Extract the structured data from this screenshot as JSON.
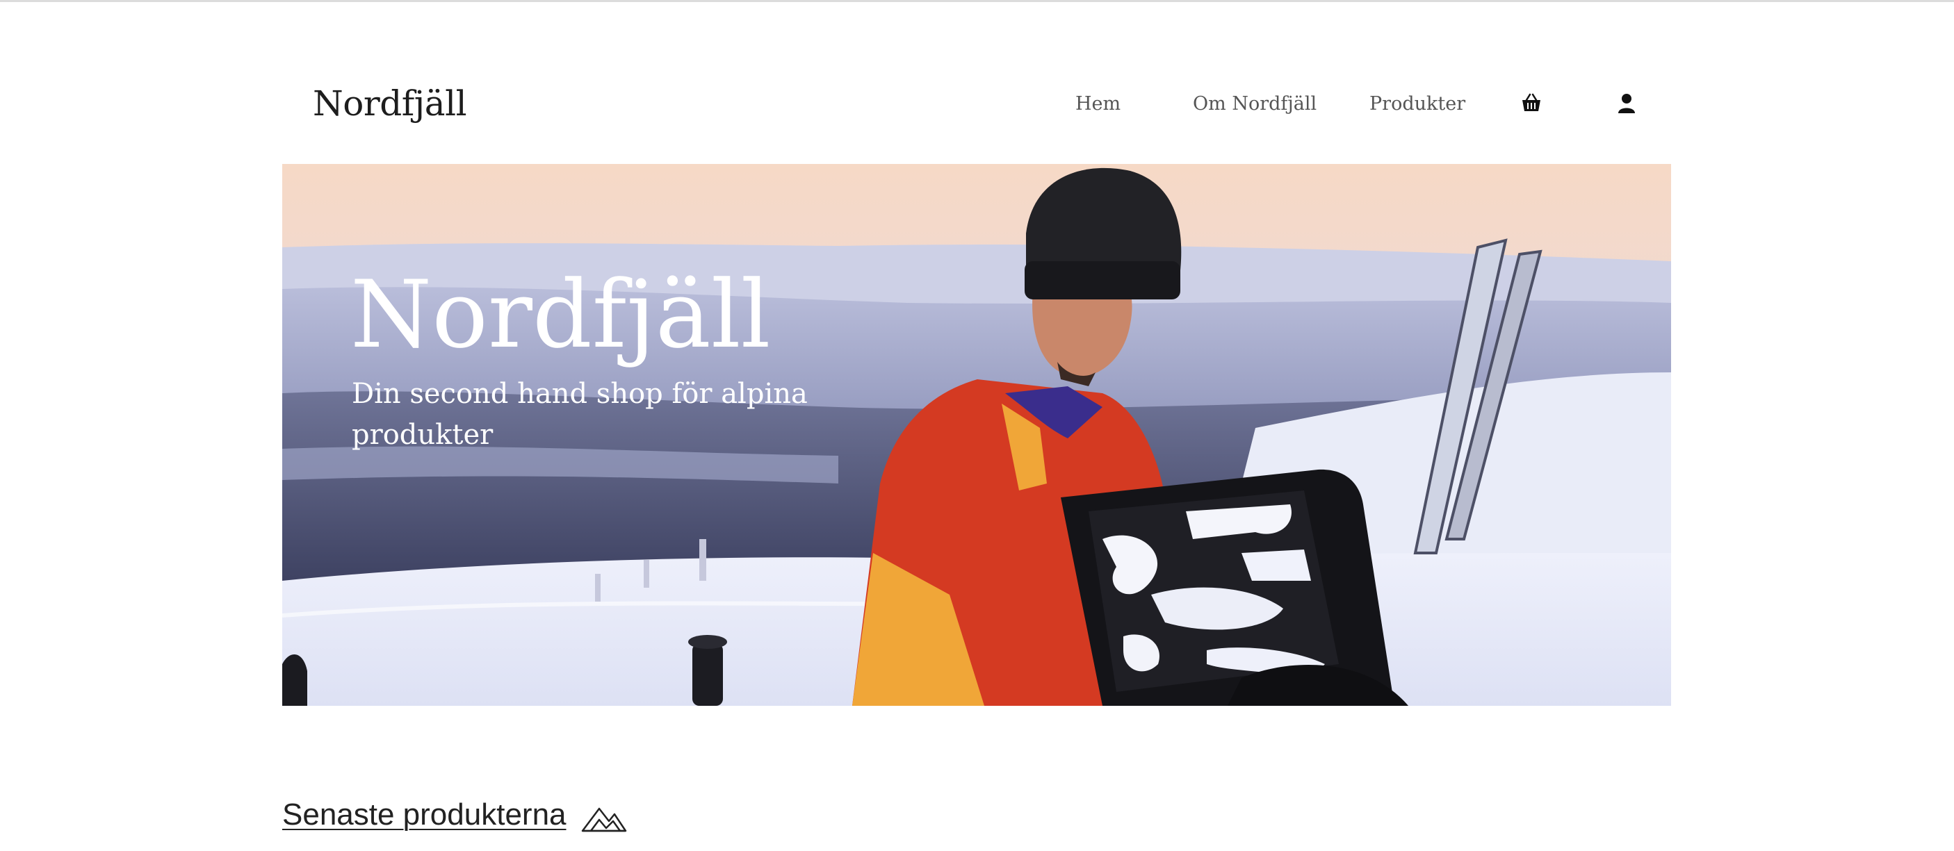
{
  "header": {
    "logo": "Nordfjäll",
    "nav": [
      {
        "label": "Hem"
      },
      {
        "label": "Om Nordfjäll"
      },
      {
        "label": "Produkter"
      }
    ],
    "icons": [
      "basket-icon",
      "user-icon"
    ]
  },
  "hero": {
    "title": "Nordfjäll",
    "subtitle": "Din second hand shop för alpina produkter"
  },
  "latest": {
    "title": "Senaste produkterna",
    "icon": "mountain-icon"
  },
  "colors": {
    "text": "#222222",
    "hero_text": "#ffffff",
    "jacket_red": "#d43a22",
    "jacket_yellow": "#f0a638"
  }
}
